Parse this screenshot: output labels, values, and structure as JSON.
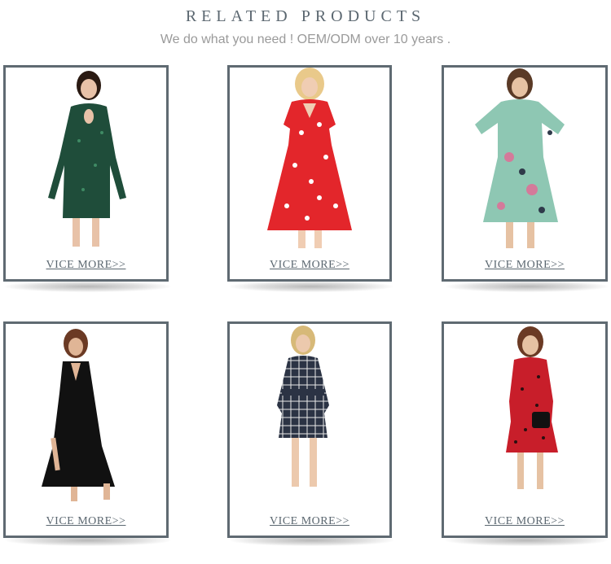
{
  "header": {
    "title": "RELATED PRODUCTS",
    "subtitle": "We do what you need ! OEM/ODM over 10 years ."
  },
  "colors": {
    "frame": "#5f6a72",
    "title": "#5b6770",
    "subtitle": "#9a9a9a"
  },
  "products": [
    {
      "link_label": "VICE MORE>>",
      "dress": "green-sequin-dress",
      "dress_color": "#1f4d3a"
    },
    {
      "link_label": "VICE MORE>>",
      "dress": "red-floral-dress",
      "dress_color": "#e3262b"
    },
    {
      "link_label": "VICE MORE>>",
      "dress": "mint-floral-dress",
      "dress_color": "#8ec7b3"
    },
    {
      "link_label": "VICE MORE>>",
      "dress": "black-maxi-dress",
      "dress_color": "#111111"
    },
    {
      "link_label": "VICE MORE>>",
      "dress": "plaid-shirt-dress",
      "dress_color": "#2b3344"
    },
    {
      "link_label": "VICE MORE>>",
      "dress": "red-polka-dot-dress",
      "dress_color": "#c81e2a"
    }
  ]
}
